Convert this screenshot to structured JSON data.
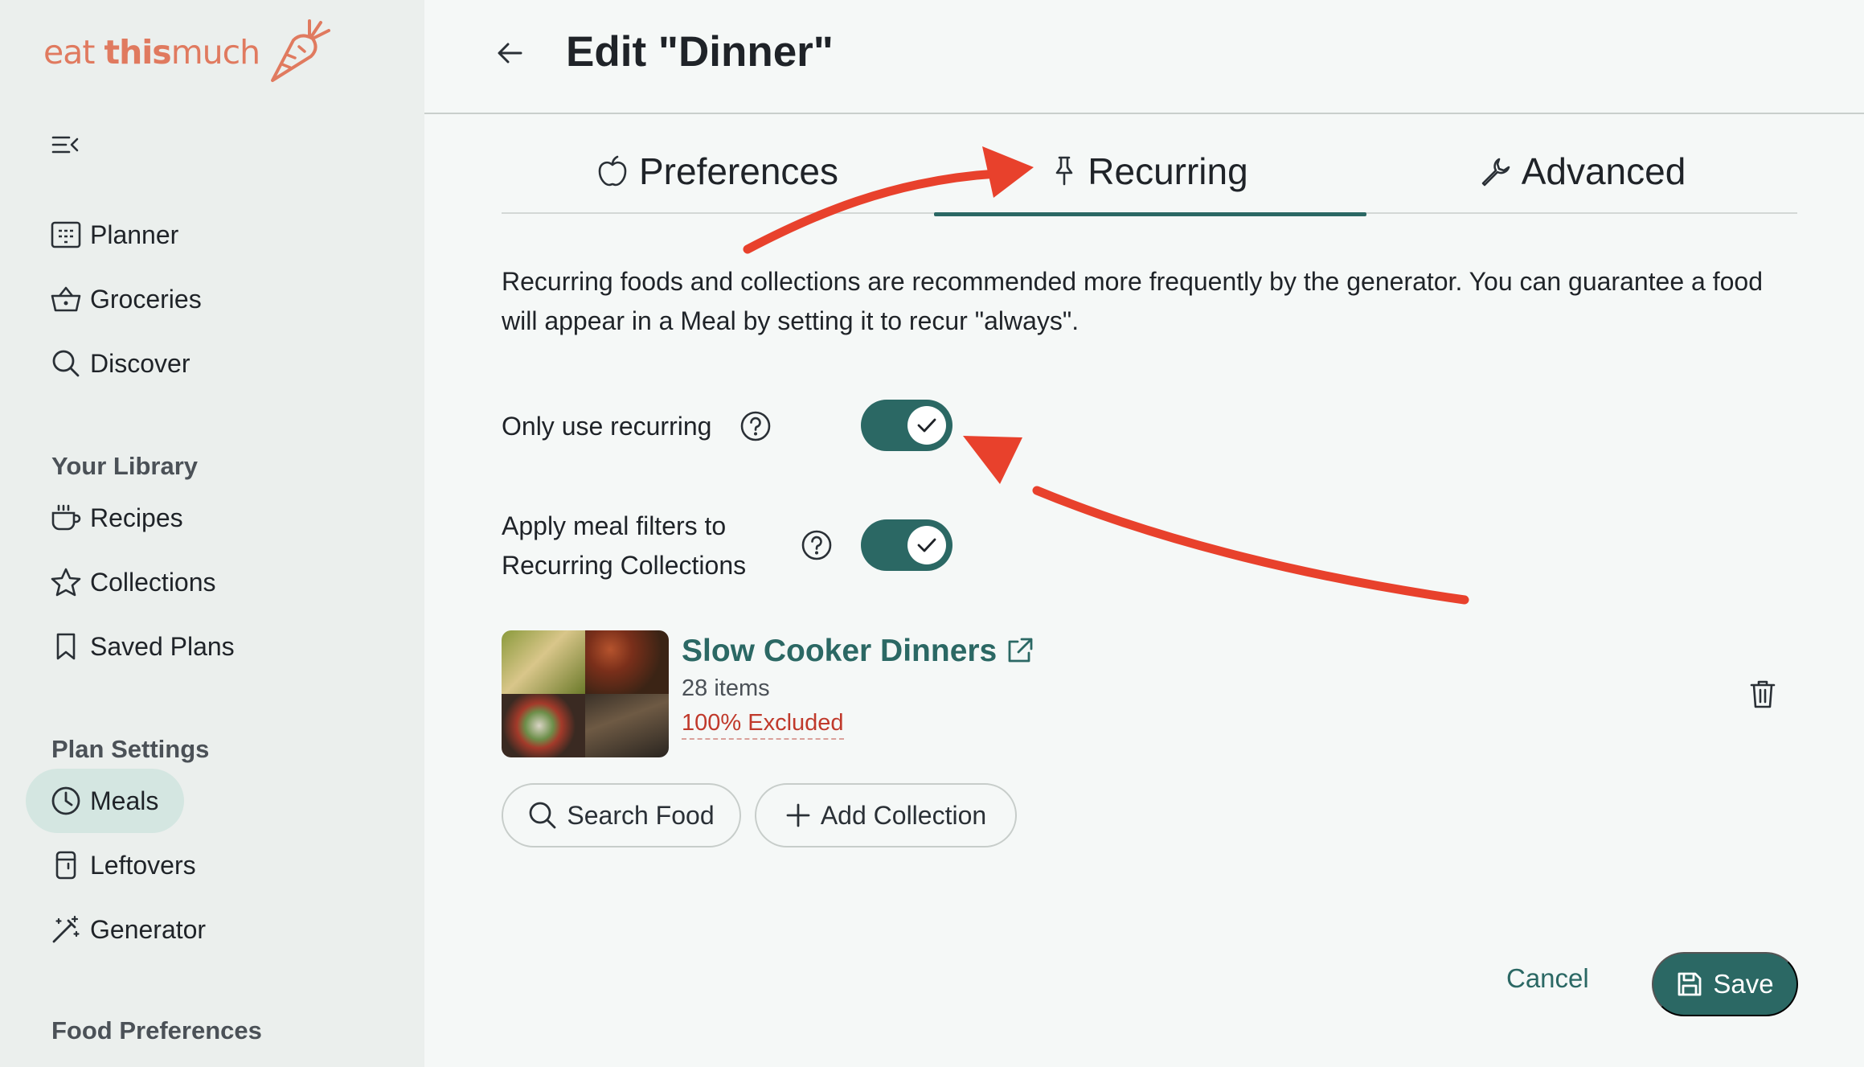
{
  "brand": {
    "name_light": "eat ",
    "name_bold": "this",
    "name_tail": "much",
    "color": "#e07a5f"
  },
  "sidebar": {
    "collapse_icon": "menu-collapse-icon",
    "main_items": [
      {
        "label": "Planner",
        "icon": "calendar-icon"
      },
      {
        "label": "Groceries",
        "icon": "basket-icon"
      },
      {
        "label": "Discover",
        "icon": "search-icon"
      }
    ],
    "library_heading": "Your Library",
    "library_items": [
      {
        "label": "Recipes",
        "icon": "cup-icon"
      },
      {
        "label": "Collections",
        "icon": "star-icon"
      },
      {
        "label": "Saved Plans",
        "icon": "bookmark-icon"
      }
    ],
    "plan_heading": "Plan Settings",
    "plan_items": [
      {
        "label": "Meals",
        "icon": "clock-icon",
        "active": true
      },
      {
        "label": "Leftovers",
        "icon": "container-icon"
      },
      {
        "label": "Generator",
        "icon": "magic-wand-icon"
      }
    ],
    "food_heading": "Food Preferences"
  },
  "header": {
    "title": "Edit \"Dinner\"",
    "back_icon": "arrow-left-icon"
  },
  "tabs": [
    {
      "label": "Preferences",
      "icon": "apple-icon"
    },
    {
      "label": "Recurring",
      "icon": "pin-icon",
      "active": true
    },
    {
      "label": "Advanced",
      "icon": "wrench-icon"
    }
  ],
  "description": "Recurring foods and collections are recommended more frequently by the generator. You can guarantee a food will appear in a Meal by setting it to recur \"always\".",
  "settings": {
    "only_recurring": {
      "label": "Only use recurring",
      "enabled": true
    },
    "apply_filters": {
      "label_line1": "Apply meal filters to",
      "label_line2": "Recurring Collections",
      "enabled": true
    }
  },
  "collection": {
    "name": "Slow Cooker Dinners",
    "count": "28 items",
    "excluded": "100% Excluded"
  },
  "actions": {
    "search_food": "Search Food",
    "add_collection": "Add Collection",
    "cancel": "Cancel",
    "save": "Save"
  },
  "colors": {
    "accent": "#2b6864",
    "annotation": "#e8412c",
    "danger": "#c0392b"
  }
}
